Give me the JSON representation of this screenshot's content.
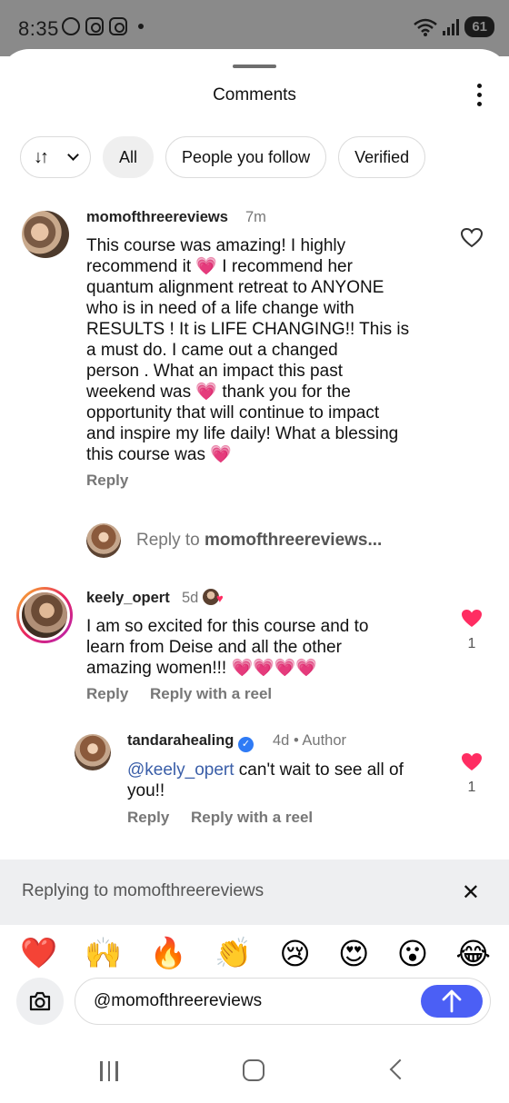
{
  "status": {
    "time": "8:35",
    "battery": "61"
  },
  "sheet": {
    "title": "Comments"
  },
  "filters": {
    "sort_arrows": "↓↑",
    "items": [
      "All",
      "People you follow",
      "Verified"
    ]
  },
  "comments": [
    {
      "username": "momofthreereviews",
      "time": "7m",
      "lines": [
        "This course was amazing! I highly",
        "recommend it 💗 I recommend her",
        "quantum alignment retreat to ANYONE",
        "who is in need of a life change with",
        "RESULTS !  It is LIFE CHANGING!! This is",
        "a must do. I came out a changed",
        "person . What an impact this past",
        "weekend was 💗 thank you for the",
        "opportunity that will continue to impact",
        "and inspire my life daily! What a blessing",
        "this course was 💗"
      ],
      "reply_label": "Reply"
    },
    {
      "username": "keely_opert",
      "time": "5d",
      "lines": [
        "I am so excited for this course and to",
        "learn from Deise and all the other",
        "amazing women!!! 💗💗💗💗"
      ],
      "reply_label": "Reply",
      "reply_reel_label": "Reply with a reel",
      "likes": "1"
    },
    {
      "username": "tandarahealing",
      "time": "4d",
      "author_label": "Author",
      "mention": "@keely_opert",
      "line1_rest": " can't wait to see all of",
      "line2": "you!!",
      "reply_label": "Reply",
      "reply_reel_label": "Reply with a reel",
      "likes": "1"
    }
  ],
  "reply_prompt": {
    "prefix": "Reply to ",
    "target": "momofthreereviews..."
  },
  "replying_bar": {
    "text": "Replying to momofthreereviews",
    "close": "✕"
  },
  "emojis": [
    "❤️",
    "🙌",
    "🔥",
    "👏",
    "😢",
    "😍",
    "😮",
    "😂"
  ],
  "composer": {
    "value": "@momofthreereviews"
  },
  "icons": {
    "heart_outline": "heart-outline-icon",
    "heart_filled": "heart-filled-icon",
    "camera": "camera-icon",
    "send": "send-arrow-icon"
  },
  "colors": {
    "like": "#ff2d62",
    "send": "#4b5ff5",
    "mention": "#3a5ea8",
    "verified": "#2f7bf5"
  }
}
